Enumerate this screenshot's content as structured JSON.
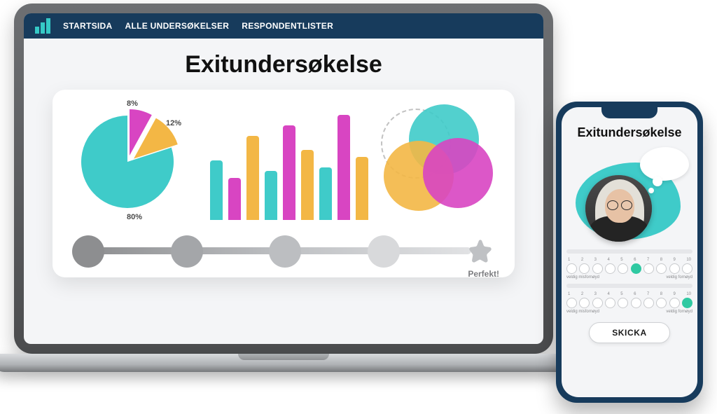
{
  "nav": {
    "links": [
      "STARTSIDA",
      "ALLE UNDERSØKELSER",
      "RESPONDENTLISTER"
    ]
  },
  "page_title": "Exitundersøkelse",
  "colors": {
    "teal": "#3fcbc9",
    "magenta": "#d845c2",
    "amber": "#f3b745",
    "navy": "#173b5c"
  },
  "chart_data": [
    {
      "type": "pie",
      "values": [
        80,
        12,
        8
      ],
      "labels": [
        "80%",
        "12%",
        "8%"
      ],
      "series_colors": [
        "#3fcbc9",
        "#f3b745",
        "#d845c2"
      ]
    },
    {
      "type": "bar",
      "values": [
        85,
        60,
        120,
        70,
        135,
        100,
        75,
        150,
        90
      ],
      "colors": [
        "#3fcbc9",
        "#d845c2",
        "#f3b745",
        "#3fcbc9",
        "#d845c2",
        "#f3b745",
        "#3fcbc9",
        "#d845c2",
        "#f3b745"
      ],
      "ylim": [
        0,
        160
      ]
    },
    {
      "type": "venn",
      "sets": [
        "teal",
        "amber",
        "magenta"
      ]
    }
  ],
  "rating": {
    "steps": 5,
    "perfekt_label": "Perfekt!",
    "dot_colors": [
      "#8d8e90",
      "#a4a6a9",
      "#bcbec1",
      "#d8d9db",
      "#e7e8ea"
    ]
  },
  "phone": {
    "title": "Exitundersøkelse",
    "scales": [
      {
        "numbers": [
          1,
          2,
          3,
          4,
          5,
          6,
          7,
          8,
          9,
          10
        ],
        "selected": 6,
        "left_label": "veldig misfornøyd",
        "right_label": "veldig fornøyd"
      },
      {
        "numbers": [
          1,
          2,
          3,
          4,
          5,
          6,
          7,
          8,
          9,
          10
        ],
        "selected": 10,
        "left_label": "veldig misfornøyd",
        "right_label": "veldig fornøyd"
      }
    ],
    "send_label": "SKICKA"
  }
}
